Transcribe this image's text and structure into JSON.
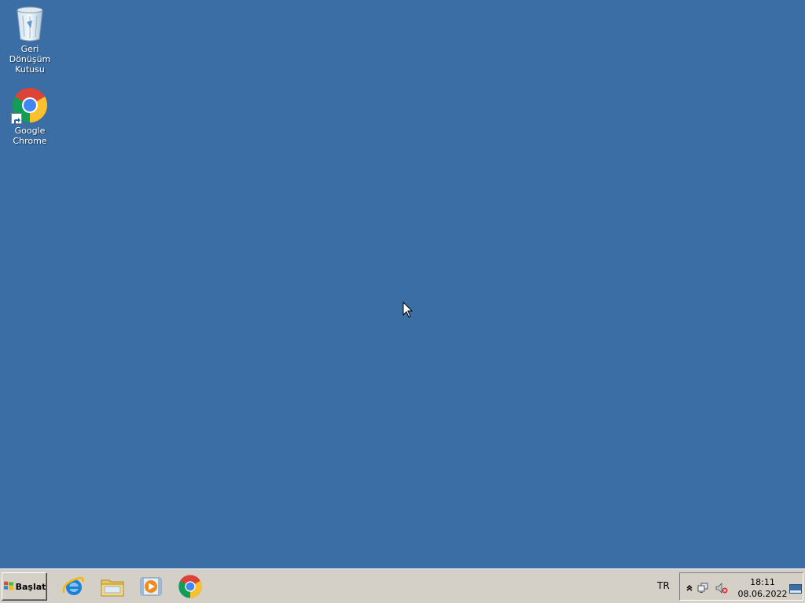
{
  "desktop": {
    "background": "#3b6ea5",
    "icons": [
      {
        "label_line1": "Geri Dönüşüm",
        "label_line2": "Kutusu",
        "icon": "recycle-bin-icon"
      },
      {
        "label": "Google Chrome",
        "icon": "chrome-icon"
      }
    ]
  },
  "taskbar": {
    "start_label": "Başlat",
    "pinned": [
      {
        "icon": "internet-explorer-icon"
      },
      {
        "icon": "file-explorer-icon"
      },
      {
        "icon": "media-player-icon"
      },
      {
        "icon": "chrome-icon"
      }
    ],
    "language": "TR",
    "tray_icons": [
      "show-hidden-icons-icon",
      "network-icon",
      "volume-muted-icon"
    ],
    "time": "18:11",
    "date": "08.06.2022"
  }
}
